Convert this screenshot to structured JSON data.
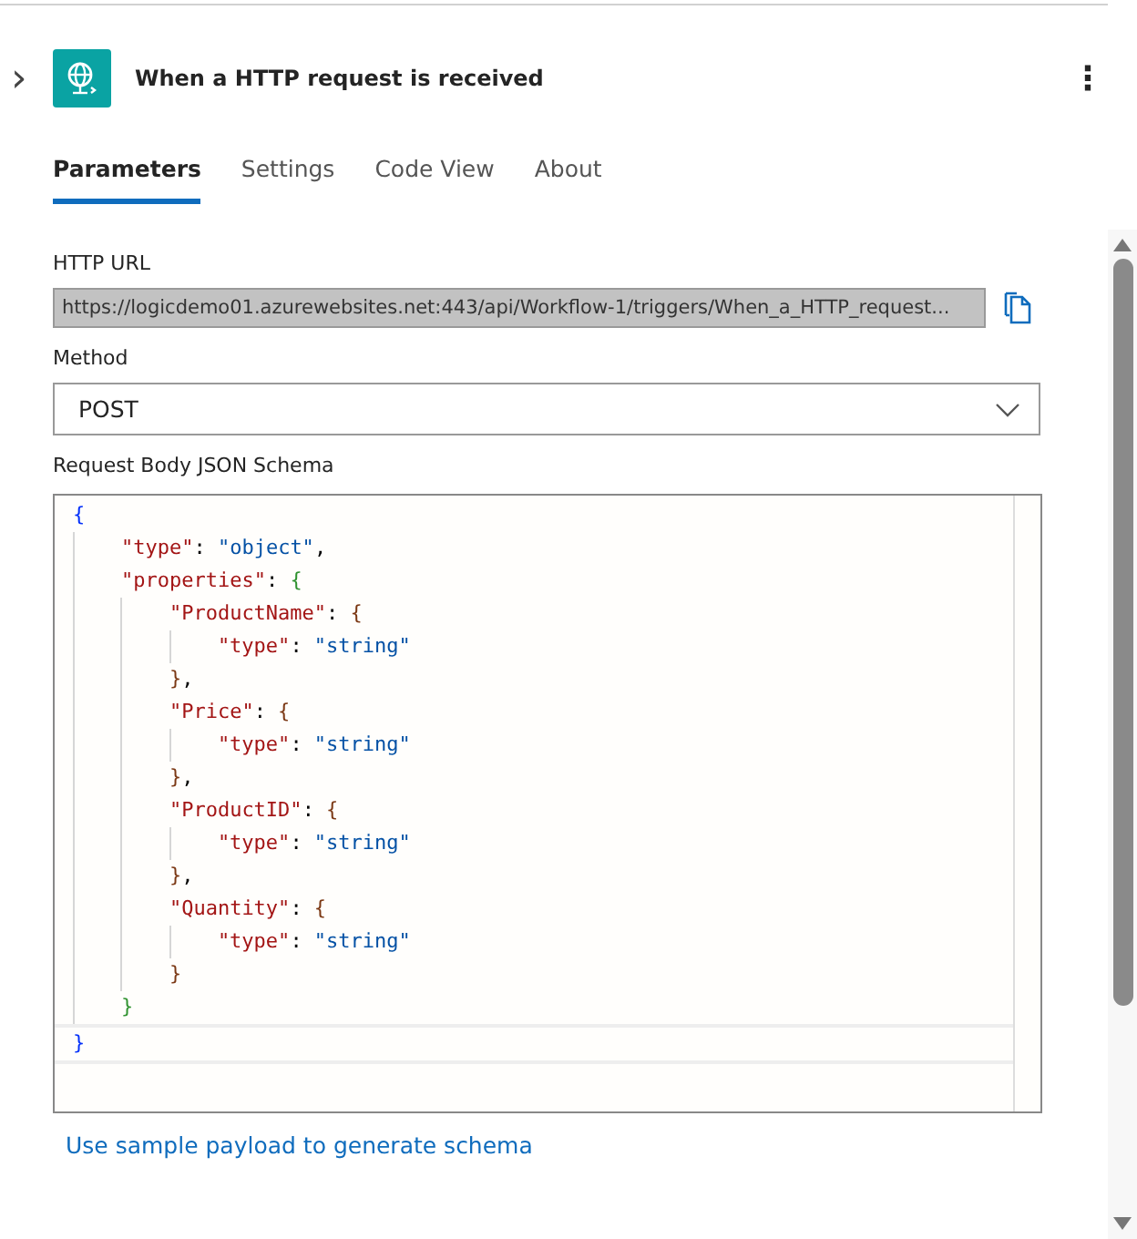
{
  "header": {
    "expand_glyph": "›",
    "title": "When a HTTP request is received",
    "more_glyph": "⋮"
  },
  "tabs": [
    {
      "label": "Parameters",
      "selected": true
    },
    {
      "label": "Settings",
      "selected": false
    },
    {
      "label": "Code View",
      "selected": false
    },
    {
      "label": "About",
      "selected": false
    }
  ],
  "url": {
    "label": "HTTP URL",
    "value": "https://logicdemo01.azurewebsites.net:443/api/Workflow-1/triggers/When_a_HTTP_request..."
  },
  "method": {
    "label": "Method",
    "value": "POST"
  },
  "schema": {
    "label": "Request Body JSON Schema",
    "lines": [
      {
        "tokens": [
          {
            "kind": "b1",
            "text": "{"
          }
        ],
        "children": [
          {
            "tokens": [
              {
                "kind": "key",
                "text": "\"type\""
              },
              {
                "kind": "p",
                "text": ":"
              },
              {
                "kind": "str",
                "text": "\"object\""
              },
              {
                "kind": "p",
                "text": ","
              }
            ]
          },
          {
            "tokens": [
              {
                "kind": "key",
                "text": "\"properties\""
              },
              {
                "kind": "p",
                "text": ":"
              },
              {
                "kind": "b2",
                "text": "{"
              }
            ],
            "children": [
              {
                "tokens": [
                  {
                    "kind": "key",
                    "text": "\"ProductName\""
                  },
                  {
                    "kind": "p",
                    "text": ":"
                  },
                  {
                    "kind": "b3",
                    "text": "{"
                  }
                ],
                "children": [
                  {
                    "tokens": [
                      {
                        "kind": "key",
                        "text": "\"type\""
                      },
                      {
                        "kind": "p",
                        "text": ":"
                      },
                      {
                        "kind": "str",
                        "text": "\"string\""
                      }
                    ]
                  }
                ]
              },
              {
                "tokens": [
                  {
                    "kind": "b3",
                    "text": "}"
                  },
                  {
                    "kind": "p",
                    "text": ","
                  }
                ]
              },
              {
                "tokens": [
                  {
                    "kind": "key",
                    "text": "\"Price\""
                  },
                  {
                    "kind": "p",
                    "text": ":"
                  },
                  {
                    "kind": "b3",
                    "text": "{"
                  }
                ],
                "children": [
                  {
                    "tokens": [
                      {
                        "kind": "key",
                        "text": "\"type\""
                      },
                      {
                        "kind": "p",
                        "text": ":"
                      },
                      {
                        "kind": "str",
                        "text": "\"string\""
                      }
                    ]
                  }
                ]
              },
              {
                "tokens": [
                  {
                    "kind": "b3",
                    "text": "}"
                  },
                  {
                    "kind": "p",
                    "text": ","
                  }
                ]
              },
              {
                "tokens": [
                  {
                    "kind": "key",
                    "text": "\"ProductID\""
                  },
                  {
                    "kind": "p",
                    "text": ":"
                  },
                  {
                    "kind": "b3",
                    "text": "{"
                  }
                ],
                "children": [
                  {
                    "tokens": [
                      {
                        "kind": "key",
                        "text": "\"type\""
                      },
                      {
                        "kind": "p",
                        "text": ":"
                      },
                      {
                        "kind": "str",
                        "text": "\"string\""
                      }
                    ]
                  }
                ]
              },
              {
                "tokens": [
                  {
                    "kind": "b3",
                    "text": "}"
                  },
                  {
                    "kind": "p",
                    "text": ","
                  }
                ]
              },
              {
                "tokens": [
                  {
                    "kind": "key",
                    "text": "\"Quantity\""
                  },
                  {
                    "kind": "p",
                    "text": ":"
                  },
                  {
                    "kind": "b3",
                    "text": "{"
                  }
                ],
                "children": [
                  {
                    "tokens": [
                      {
                        "kind": "key",
                        "text": "\"type\""
                      },
                      {
                        "kind": "p",
                        "text": ":"
                      },
                      {
                        "kind": "str",
                        "text": "\"string\""
                      }
                    ]
                  }
                ]
              },
              {
                "tokens": [
                  {
                    "kind": "b3",
                    "text": "}"
                  }
                ]
              }
            ]
          },
          {
            "tokens": [
              {
                "kind": "b2",
                "text": "}"
              }
            ]
          }
        ]
      },
      {
        "tokens": [
          {
            "kind": "b1",
            "text": "}"
          }
        ]
      }
    ]
  },
  "link": "Use sample payload to generate schema"
}
